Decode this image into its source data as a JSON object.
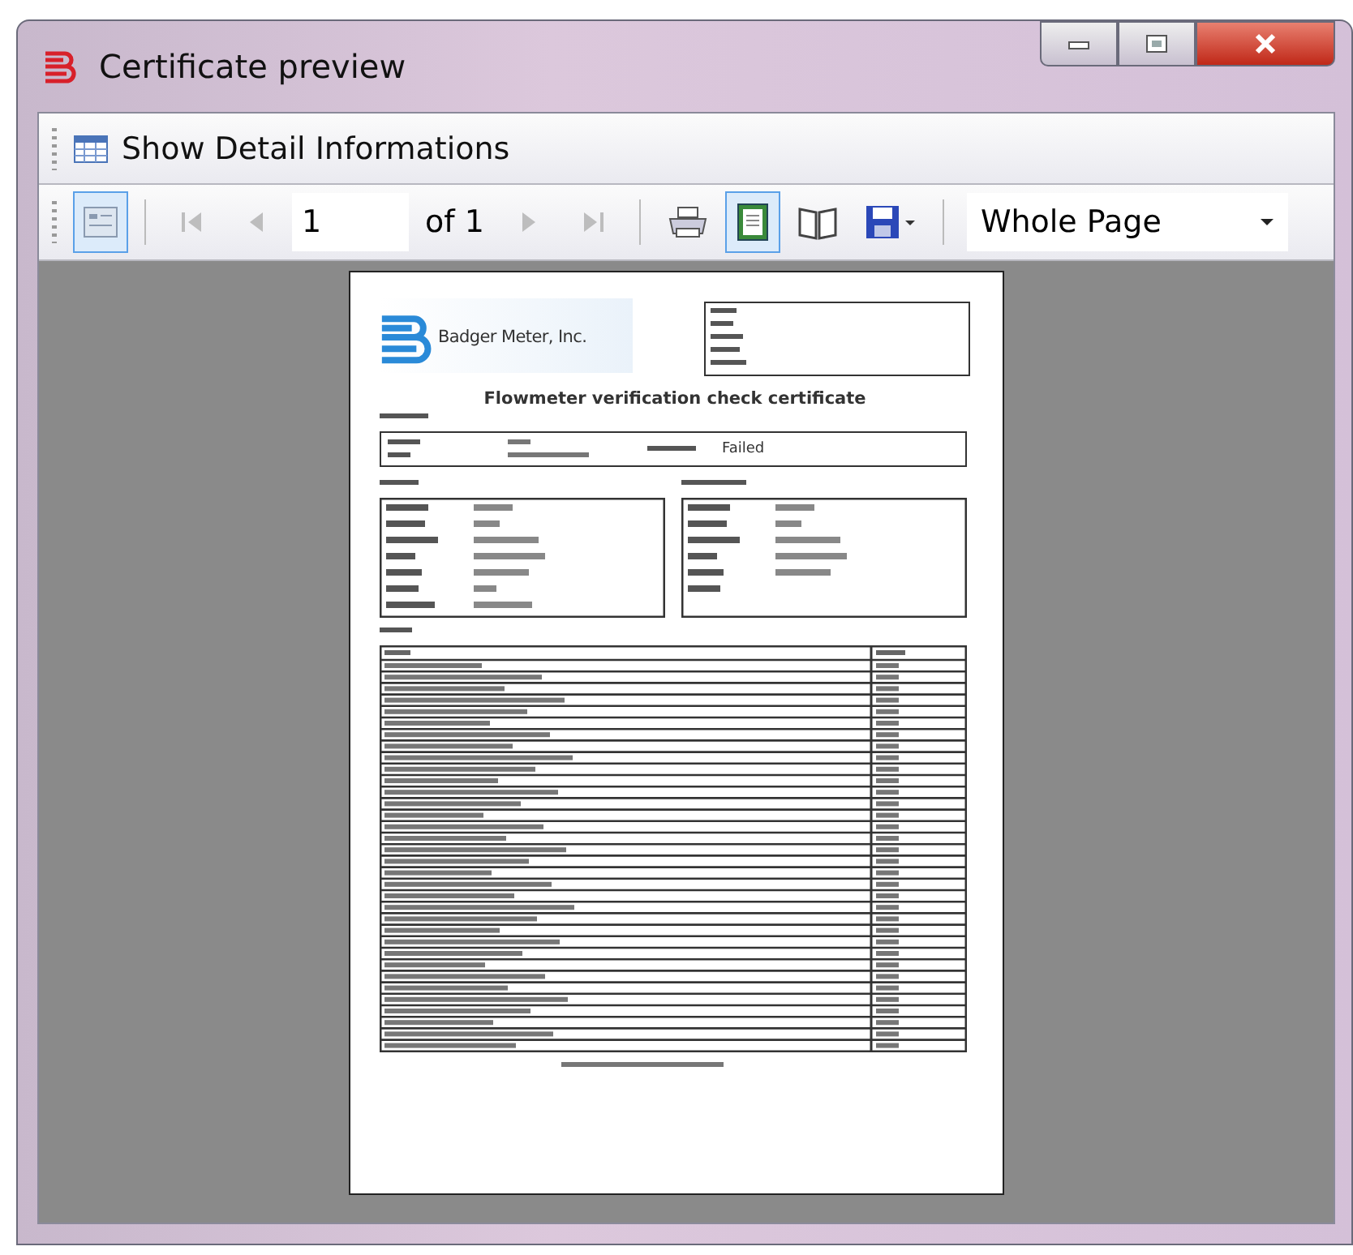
{
  "window": {
    "title": "Certificate preview"
  },
  "detail_toolbar": {
    "button": "Show Detail Informations"
  },
  "tools": [
    {
      "kind": "thumbnails",
      "selected": true,
      "disabled": false
    },
    {
      "kind": "first",
      "selected": false,
      "disabled": true
    },
    {
      "kind": "previous",
      "selected": false,
      "disabled": true
    },
    {
      "kind": "page",
      "value": "1",
      "of_label": "of",
      "count": "1"
    },
    {
      "kind": "next",
      "selected": false,
      "disabled": true
    },
    {
      "kind": "last",
      "selected": false,
      "disabled": true
    },
    {
      "kind": "print",
      "selected": false,
      "disabled": false
    },
    {
      "kind": "single_page",
      "selected": true,
      "disabled": false
    },
    {
      "kind": "two_pages",
      "selected": false,
      "disabled": false
    },
    {
      "kind": "save",
      "selected": false,
      "disabled": false
    },
    {
      "kind": "zoom",
      "value": "Whole Page"
    }
  ],
  "document": {
    "company": "Badger Meter, Inc.",
    "title": "Flowmeter verification check certificate",
    "final_result": "Failed"
  }
}
